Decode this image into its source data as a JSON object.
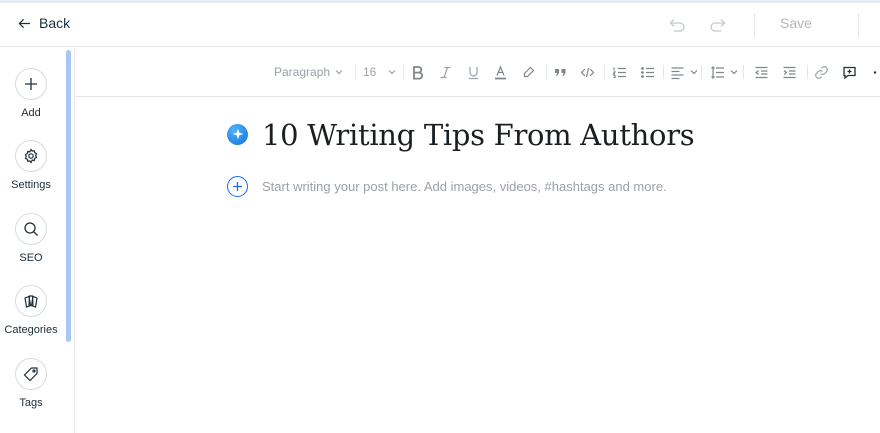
{
  "header": {
    "back_label": "Back",
    "save_label": "Save"
  },
  "sidebar": {
    "items": [
      {
        "label": "Add",
        "icon": "plus-icon"
      },
      {
        "label": "Settings",
        "icon": "gear-icon"
      },
      {
        "label": "SEO",
        "icon": "search-icon"
      },
      {
        "label": "Categories",
        "icon": "categories-icon"
      },
      {
        "label": "Tags",
        "icon": "tag-icon"
      }
    ]
  },
  "toolbar": {
    "paragraph_style": "Paragraph",
    "font_size": "16",
    "icons": [
      "bold-icon",
      "italic-icon",
      "underline-icon",
      "text-color-icon",
      "highlight-icon",
      "quote-icon",
      "code-icon",
      "numbered-list-icon",
      "bulleted-list-icon",
      "align-icon",
      "line-spacing-icon",
      "decrease-indent-icon",
      "increase-indent-icon",
      "link-icon",
      "comment-icon",
      "more-icon"
    ]
  },
  "editor": {
    "title": "10 Writing Tips From Authors",
    "placeholder": "Start writing your post here. Add images, videos, #hashtags and more."
  },
  "colors": {
    "accent": "#116dff",
    "scrollbar": "#a9c6f5",
    "muted_text": "#9aa1a8",
    "border": "#e3e6ea"
  }
}
